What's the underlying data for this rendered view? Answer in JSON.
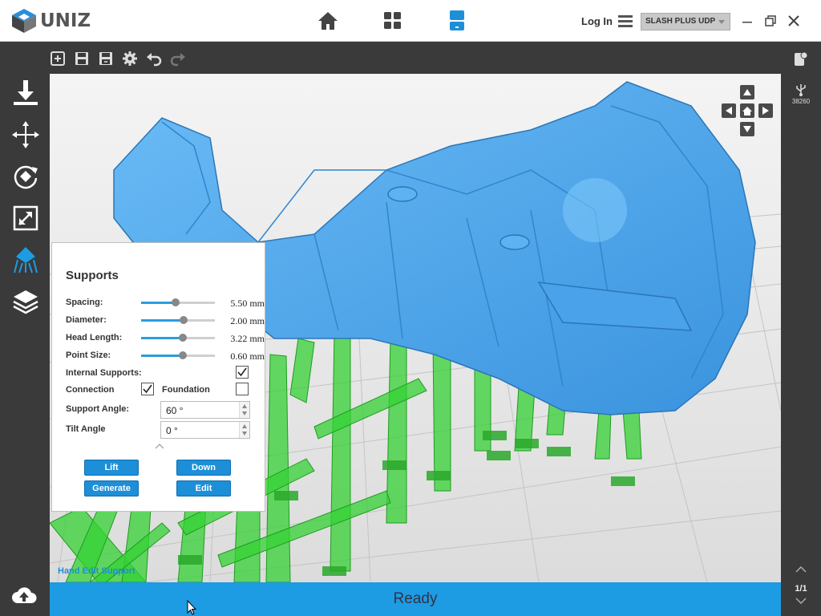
{
  "app": {
    "logo_text": "UNIZ"
  },
  "header": {
    "nav": [
      "home-icon",
      "grid-icon",
      "printer-icon"
    ],
    "login_label": "Log In",
    "printer_select": "SLASH PLUS UDP",
    "window_controls": [
      "minimize-icon",
      "restore-icon",
      "close-icon"
    ]
  },
  "left_toolbar": [
    "import-icon",
    "move-icon",
    "rotate-icon",
    "scale-icon",
    "supports-icon",
    "layers-icon"
  ],
  "top_toolbar": [
    "new-icon",
    "save-icon",
    "save-as-icon",
    "settings-icon",
    "undo-icon",
    "redo-icon"
  ],
  "right_panel": {
    "usb_count": "38260",
    "page": "1/1"
  },
  "supports": {
    "title": "Supports",
    "sliders": [
      {
        "label": "Spacing:",
        "value": "5.50 mm",
        "fraction": 0.47
      },
      {
        "label": "Diameter:",
        "value": "2.00 mm",
        "fraction": 0.58
      },
      {
        "label": "Head Length:",
        "value": "3.22 mm",
        "fraction": 0.56
      },
      {
        "label": "Point Size:",
        "value": "0.60 mm",
        "fraction": 0.56
      }
    ],
    "internal_label": "Internal Supports:",
    "internal_checked": true,
    "connection_label": "Connection",
    "connection_checked": true,
    "foundation_label": "Foundation",
    "foundation_checked": false,
    "support_angle_label": "Support Angle:",
    "support_angle_value": "60 °",
    "tilt_angle_label": "Tilt Angle",
    "tilt_angle_value": "0 °",
    "buttons": {
      "lift": "Lift",
      "down": "Down",
      "generate": "Generate",
      "edit": "Edit"
    }
  },
  "viewport": {
    "sub_label": "Hand Edit Support"
  },
  "status": {
    "text": "Ready"
  },
  "colors": {
    "accent": "#1d9be3",
    "model": "#4aa8f0",
    "support": "#2fcf2f"
  }
}
